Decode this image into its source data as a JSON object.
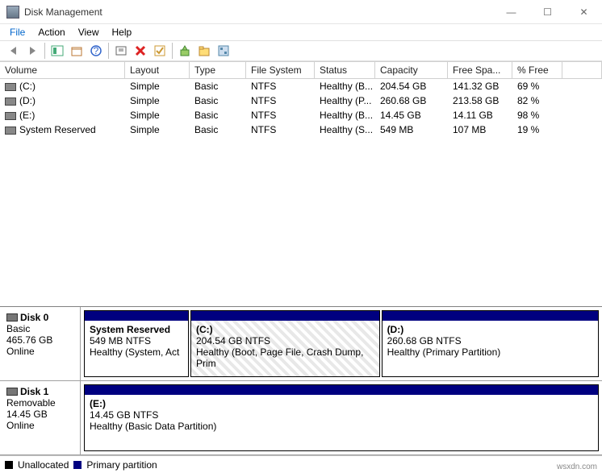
{
  "window": {
    "title": "Disk Management",
    "btn_min": "—",
    "btn_max": "☐",
    "btn_close": "✕"
  },
  "menu": {
    "file": "File",
    "action": "Action",
    "view": "View",
    "help": "Help"
  },
  "columns": {
    "c0": "Volume",
    "c1": "Layout",
    "c2": "Type",
    "c3": "File System",
    "c4": "Status",
    "c5": "Capacity",
    "c6": "Free Spa...",
    "c7": "% Free"
  },
  "rows": [
    {
      "vol": "(C:)",
      "layout": "Simple",
      "type": "Basic",
      "fs": "NTFS",
      "status": "Healthy (B...",
      "cap": "204.54 GB",
      "free": "141.32 GB",
      "pct": "69 %"
    },
    {
      "vol": "(D:)",
      "layout": "Simple",
      "type": "Basic",
      "fs": "NTFS",
      "status": "Healthy (P...",
      "cap": "260.68 GB",
      "free": "213.58 GB",
      "pct": "82 %"
    },
    {
      "vol": "(E:)",
      "layout": "Simple",
      "type": "Basic",
      "fs": "NTFS",
      "status": "Healthy (B...",
      "cap": "14.45 GB",
      "free": "14.11 GB",
      "pct": "98 %"
    },
    {
      "vol": "System Reserved",
      "layout": "Simple",
      "type": "Basic",
      "fs": "NTFS",
      "status": "Healthy (S...",
      "cap": "549 MB",
      "free": "107 MB",
      "pct": "19 %"
    }
  ],
  "disk0": {
    "name": "Disk 0",
    "type": "Basic",
    "size": "465.76 GB",
    "state": "Online",
    "p0": {
      "title": "System Reserved",
      "sub": "549 MB NTFS",
      "health": "Healthy (System, Act"
    },
    "p1": {
      "title": "(C:)",
      "sub": "204.54 GB NTFS",
      "health": "Healthy (Boot, Page File, Crash Dump, Prim"
    },
    "p2": {
      "title": "(D:)",
      "sub": "260.68 GB NTFS",
      "health": "Healthy (Primary Partition)"
    }
  },
  "disk1": {
    "name": "Disk 1",
    "type": "Removable",
    "size": "14.45 GB",
    "state": "Online",
    "p0": {
      "title": "(E:)",
      "sub": "14.45 GB NTFS",
      "health": "Healthy (Basic Data Partition)"
    }
  },
  "legend": {
    "unalloc": "Unallocated",
    "primary": "Primary partition"
  },
  "watermark": "wsxdn.com"
}
